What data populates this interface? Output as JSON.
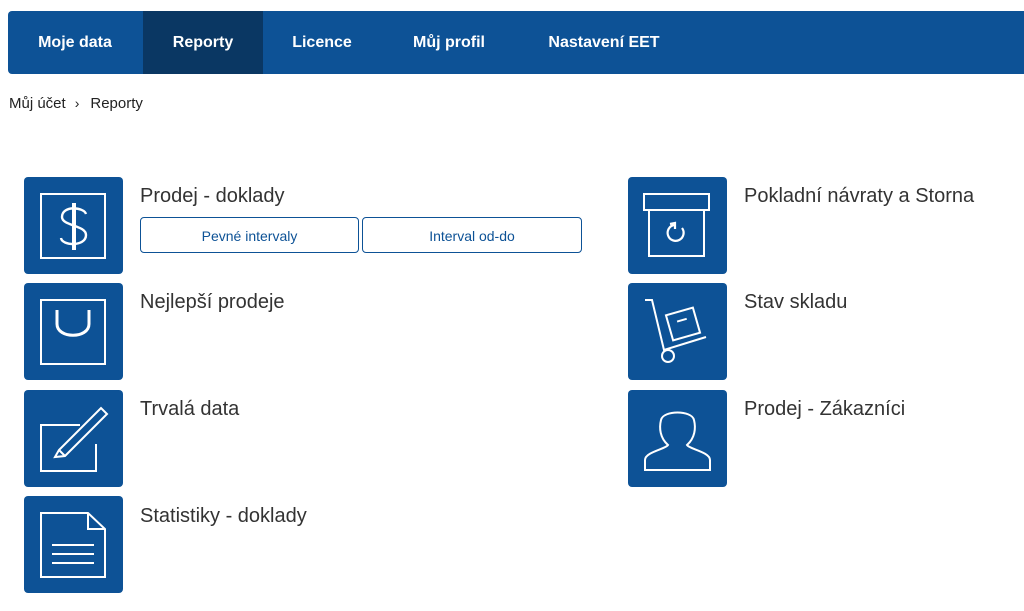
{
  "nav": {
    "items": [
      {
        "label": "Moje data"
      },
      {
        "label": "Reporty"
      },
      {
        "label": "Licence"
      },
      {
        "label": "Můj profil"
      },
      {
        "label": "Nastavení EET"
      }
    ],
    "active": "Reporty"
  },
  "breadcrumb": {
    "home": "Můj účet",
    "separator": "›",
    "current": "Reporty"
  },
  "reports": {
    "sales_documents": {
      "title": "Prodej - doklady",
      "icon": "dollar-icon",
      "buttons": {
        "fixed": "Pevné intervaly",
        "range": "Interval od-do"
      }
    },
    "returns": {
      "title": "Pokladní návraty a Storna",
      "icon": "box-return-icon"
    },
    "best_sales": {
      "title": "Nejlepší prodeje",
      "icon": "shopping-bag-icon"
    },
    "stock": {
      "title": "Stav skladu",
      "icon": "hand-truck-icon"
    },
    "master_data": {
      "title": "Trvalá data",
      "icon": "edit-icon"
    },
    "customers": {
      "title": "Prodej - Zákazníci",
      "icon": "user-icon"
    },
    "statistics": {
      "title": "Statistiky - doklady",
      "icon": "document-icon"
    }
  },
  "colors": {
    "primary": "#0d5296",
    "nav_active": "#0a3763"
  }
}
